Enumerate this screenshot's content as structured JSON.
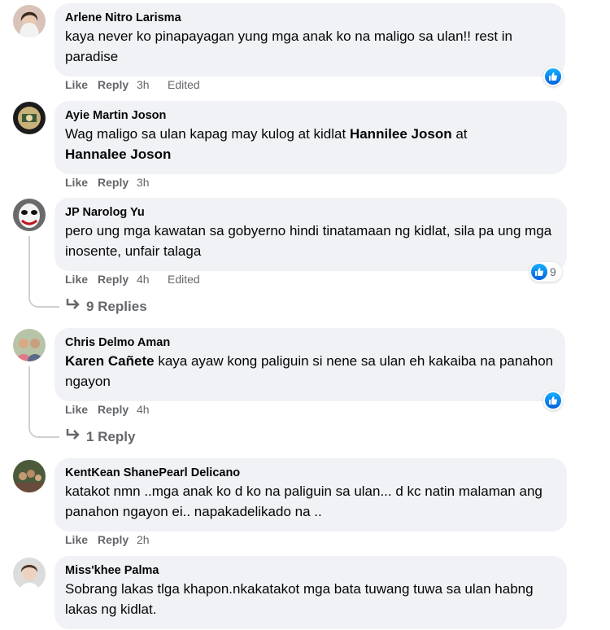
{
  "actions": {
    "like": "Like",
    "reply": "Reply"
  },
  "comments": [
    {
      "author": "Arlene Nitro Larisma",
      "text": "kaya never ko pinapayagan yung mga anak ko na maligo sa ulan!! rest in paradise",
      "time": "3h",
      "edited": "Edited"
    },
    {
      "author": "Ayie Martin Joson",
      "text_before": "Wag maligo sa ulan kapag may kulog at kidlat ",
      "mention1": "Hannilee Joson",
      "text_mid": " at ",
      "mention2": "Hannalee Joson",
      "time": "3h"
    },
    {
      "author": "JP Narolog Yu",
      "text": "pero ung mga kawatan sa gobyerno hindi tinatamaan ng kidlat, sila pa ung mga inosente, unfair talaga",
      "time": "4h",
      "edited": "Edited",
      "reaction_count": "9",
      "replies": "9 Replies"
    },
    {
      "author": "Chris Delmo Aman",
      "mention": "Karen Cañete",
      "text": " kaya ayaw kong paliguin si nene sa ulan eh kakaiba na panahon ngayon",
      "time": "4h",
      "replies": "1 Reply"
    },
    {
      "author": "KentKean ShanePearl Delicano",
      "text": "katakot nmn ..mga anak ko d ko na paliguin sa ulan... d kc natin malaman ang panahon ngayon ei.. napakadelikado na ..",
      "time": "2h"
    },
    {
      "author": "Miss'khee Palma",
      "text": "Sobrang lakas tlga khapon.nkakatakot mga bata tuwang tuwa sa ulan habng lakas ng kidlat."
    }
  ]
}
